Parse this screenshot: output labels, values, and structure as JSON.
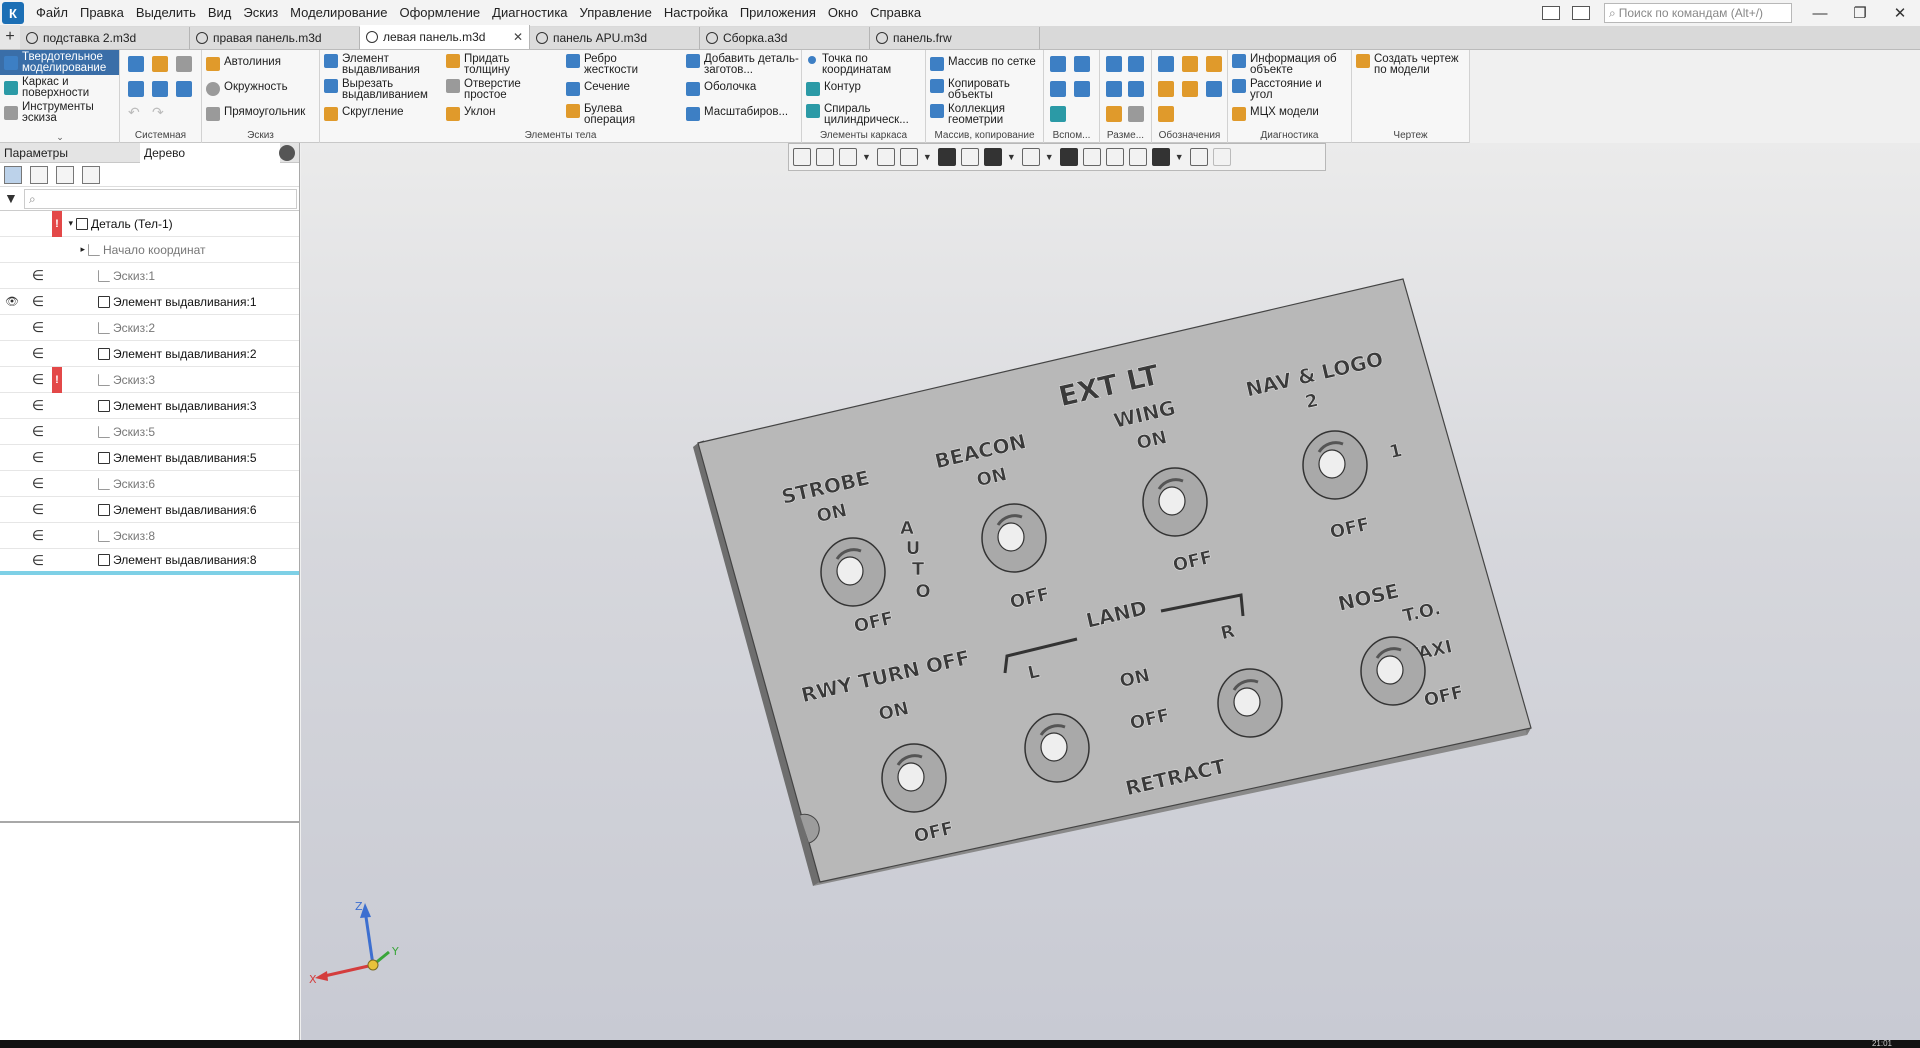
{
  "menu": [
    "Файл",
    "Правка",
    "Выделить",
    "Вид",
    "Эскиз",
    "Моделирование",
    "Оформление",
    "Диагностика",
    "Управление",
    "Настройка",
    "Приложения",
    "Окно",
    "Справка"
  ],
  "search": {
    "placeholder": "Поиск по командам (Alt+/)"
  },
  "window_controls": {
    "minimize": "—",
    "restore": "❐",
    "close": "✕"
  },
  "tabs": [
    {
      "label": "подставка 2.m3d",
      "active": false
    },
    {
      "label": "правая панель.m3d",
      "active": false
    },
    {
      "label": "левая панель.m3d",
      "active": true
    },
    {
      "label": "панель APU.m3d",
      "active": false
    },
    {
      "label": "Сборка.a3d",
      "active": false
    },
    {
      "label": "панель.frw",
      "active": false
    }
  ],
  "tab_close": "✕",
  "tab_add": "+",
  "modes": [
    "Твердотельное моделирование",
    "Каркас и поверхности",
    "Инструменты эскиза"
  ],
  "ribbon": {
    "groups": [
      "Системная",
      "Эскиз",
      "Элементы тела",
      "Элементы каркаса",
      "Массив, копирование",
      "Вспом...",
      "Разме...",
      "Обозначения",
      "Диагностика",
      "Чертеж"
    ],
    "sketch": [
      "Автолиния",
      "Окружность",
      "Прямоугольник"
    ],
    "body": [
      "Элемент выдавливания",
      "Вырезать выдавливанием",
      "Скругление",
      "Придать толщину",
      "Отверстие простое",
      "Уклон",
      "Ребро жесткости",
      "Сечение",
      "Булева операция",
      "Добавить деталь-заготов...",
      "Оболочка",
      "Масштабиров..."
    ],
    "frame": [
      "Точка по координатам",
      "Контур",
      "Спираль цилиндрическ..."
    ],
    "array": [
      "Массив по сетке",
      "Копировать объекты",
      "Коллекция геометрии"
    ],
    "diag": [
      "Информация об объекте",
      "Расстояние и угол",
      "МЦХ модели"
    ],
    "drawing": [
      "Создать чертеж по модели"
    ]
  },
  "panel": {
    "tabs": [
      "Параметры",
      "Дерево"
    ],
    "filter_placeholder": "⌕",
    "tree": [
      {
        "label": "Деталь (Тел-1)",
        "err": true,
        "eye": "",
        "dim": false,
        "type": "part",
        "vis": ""
      },
      {
        "label": "Начало координат",
        "err": false,
        "eye": "",
        "dim": true,
        "type": "origin",
        "vis": ""
      },
      {
        "label": "Эскиз:1",
        "err": false,
        "eye": "",
        "dim": true,
        "type": "sketch",
        "vis": "∈"
      },
      {
        "label": "Элемент выдавливания:1",
        "err": false,
        "eye": "👁",
        "dim": false,
        "type": "extrude",
        "vis": "∈"
      },
      {
        "label": "Эскиз:2",
        "err": false,
        "eye": "",
        "dim": true,
        "type": "sketch",
        "vis": "∈"
      },
      {
        "label": "Элемент выдавливания:2",
        "err": false,
        "eye": "",
        "dim": false,
        "type": "extrude",
        "vis": "∈"
      },
      {
        "label": "Эскиз:3",
        "err": true,
        "eye": "",
        "dim": true,
        "type": "sketch",
        "vis": "∈"
      },
      {
        "label": "Элемент выдавливания:3",
        "err": false,
        "eye": "",
        "dim": false,
        "type": "extrude",
        "vis": "∈"
      },
      {
        "label": "Эскиз:5",
        "err": false,
        "eye": "",
        "dim": true,
        "type": "sketch",
        "vis": "∈"
      },
      {
        "label": "Элемент выдавливания:5",
        "err": false,
        "eye": "",
        "dim": false,
        "type": "extrude",
        "vis": "∈"
      },
      {
        "label": "Эскиз:6",
        "err": false,
        "eye": "",
        "dim": true,
        "type": "sketch",
        "vis": "∈"
      },
      {
        "label": "Элемент выдавливания:6",
        "err": false,
        "eye": "",
        "dim": false,
        "type": "extrude",
        "vis": "∈"
      },
      {
        "label": "Эскиз:8",
        "err": false,
        "eye": "",
        "dim": true,
        "type": "sketch",
        "vis": "∈"
      },
      {
        "label": "Элемент выдавливания:8",
        "err": false,
        "eye": "",
        "dim": false,
        "type": "extrude",
        "vis": "∈"
      }
    ]
  },
  "model": {
    "labels": {
      "ext_lt": "EXT LT",
      "strobe": "STROBE",
      "strobe_on": "ON",
      "strobe_off": "OFF",
      "auto_a": "A",
      "auto_u": "U",
      "auto_t": "T",
      "auto_o": "O",
      "beacon": "BEACON",
      "beacon_on": "ON",
      "beacon_off": "OFF",
      "wing": "WING",
      "wing_on": "ON",
      "wing_off": "OFF",
      "nav_logo": "NAV & LOGO",
      "nav_2": "2",
      "nav_1": "1",
      "nav_off": "OFF",
      "land": "LAND",
      "land_l": "L",
      "land_r": "R",
      "land_on": "ON",
      "land_off": "OFF",
      "retract": "RETRACT",
      "rwy": "RWY TURN OFF",
      "rwy_on": "ON",
      "rwy_off": "OFF",
      "nose": "NOSE",
      "to": "T.O.",
      "taxi": "TAXI",
      "nose_off": "OFF"
    }
  },
  "axes": {
    "x": "X",
    "y": "Y",
    "z": "Z"
  },
  "clock": "21:01",
  "colors": {
    "accent": "#3a6ea8",
    "error": "#e34848",
    "selection": "#7ed0e6"
  }
}
